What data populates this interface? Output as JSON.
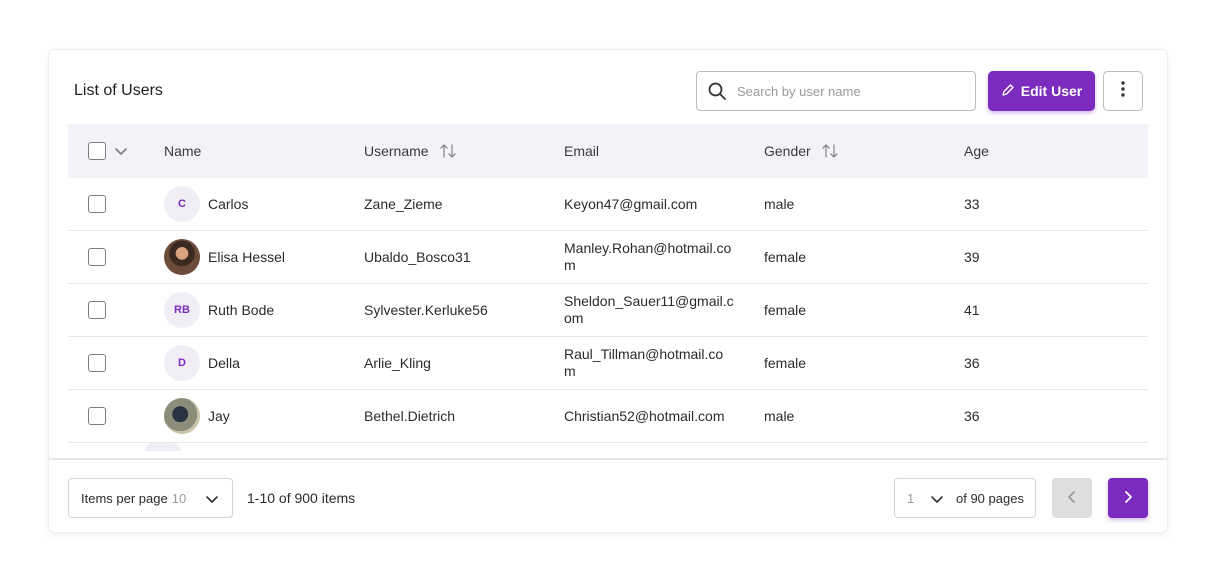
{
  "header": {
    "title": "List of Users",
    "search_placeholder": "Search by user name",
    "edit_label": "Edit User"
  },
  "table": {
    "columns": {
      "name": "Name",
      "username": "Username",
      "email": "Email",
      "gender": "Gender",
      "age": "Age"
    },
    "rows": [
      {
        "initials": "C",
        "name": "Carlos",
        "username": "Zane_Zieme",
        "email": "Keyon47@gmail.com",
        "gender": "male",
        "age": "33"
      },
      {
        "initials": "",
        "name": "Elisa Hessel",
        "username": "Ubaldo_Bosco31",
        "email": "Manley.Rohan@hotmail.com",
        "gender": "female",
        "age": "39"
      },
      {
        "initials": "RB",
        "name": "Ruth Bode",
        "username": "Sylvester.Kerluke56",
        "email": "Sheldon_Sauer11@gmail.com",
        "gender": "female",
        "age": "41"
      },
      {
        "initials": "D",
        "name": "Della",
        "username": "Arlie_Kling",
        "email": "Raul_Tillman@hotmail.com",
        "gender": "female",
        "age": "36"
      },
      {
        "initials": "",
        "name": "Jay",
        "username": "Bethel.Dietrich",
        "email": "Christian52@hotmail.com",
        "gender": "male",
        "age": "36"
      }
    ]
  },
  "footer": {
    "items_per_page_label": "Items per page",
    "items_per_page_value": "10",
    "items_count": "1-10 of 900 items",
    "current_page": "1",
    "of_pages": "of 90 pages"
  },
  "colors": {
    "accent": "#7b2cbf",
    "header_bg": "#f4f1f8"
  },
  "icons": [
    "search-icon",
    "pencil-icon",
    "more-vertical-icon",
    "chevron-down-icon",
    "sort-icon",
    "chevron-left-icon",
    "chevron-right-icon"
  ]
}
